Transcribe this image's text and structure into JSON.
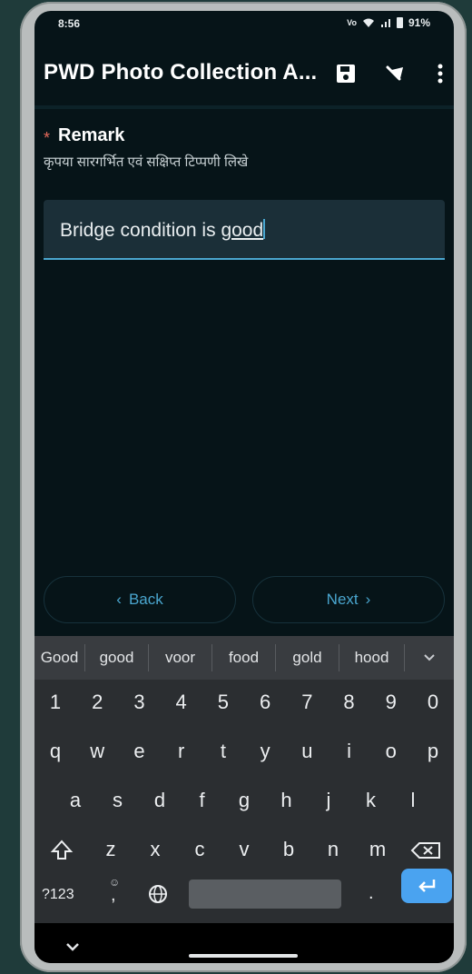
{
  "status": {
    "time": "8:56",
    "network": "Vo LTE",
    "battery": "91%"
  },
  "appbar": {
    "title": "PWD Photo Collection A...",
    "save_icon": "save-icon",
    "pin_icon": "pin-icon",
    "more_icon": "more-vert-icon"
  },
  "form": {
    "required_mark": "*",
    "label": "Remark",
    "hint": "कृपया सारगर्भित एवं सक्षिप्त टिप्पणी लिखे",
    "value_prefix": "Bridge condition is ",
    "value_word": "good"
  },
  "nav": {
    "back_label": "Back",
    "next_label": "Next",
    "back_icon": "‹",
    "next_icon": "›"
  },
  "keyboard": {
    "suggestions": [
      "Good",
      "good",
      "voor",
      "food",
      "gold",
      "hood"
    ],
    "numbers": [
      "1",
      "2",
      "3",
      "4",
      "5",
      "6",
      "7",
      "8",
      "9",
      "0"
    ],
    "row1": [
      "q",
      "w",
      "e",
      "r",
      "t",
      "y",
      "u",
      "i",
      "o",
      "p"
    ],
    "row2": [
      "a",
      "s",
      "d",
      "f",
      "g",
      "h",
      "j",
      "k",
      "l"
    ],
    "row3": [
      "z",
      "x",
      "c",
      "v",
      "b",
      "n",
      "m"
    ],
    "sym_label": "?123",
    "comma": ",",
    "period": "."
  },
  "colors": {
    "accent": "#4aa6cf",
    "background": "#061418",
    "required": "#e46a5b"
  }
}
